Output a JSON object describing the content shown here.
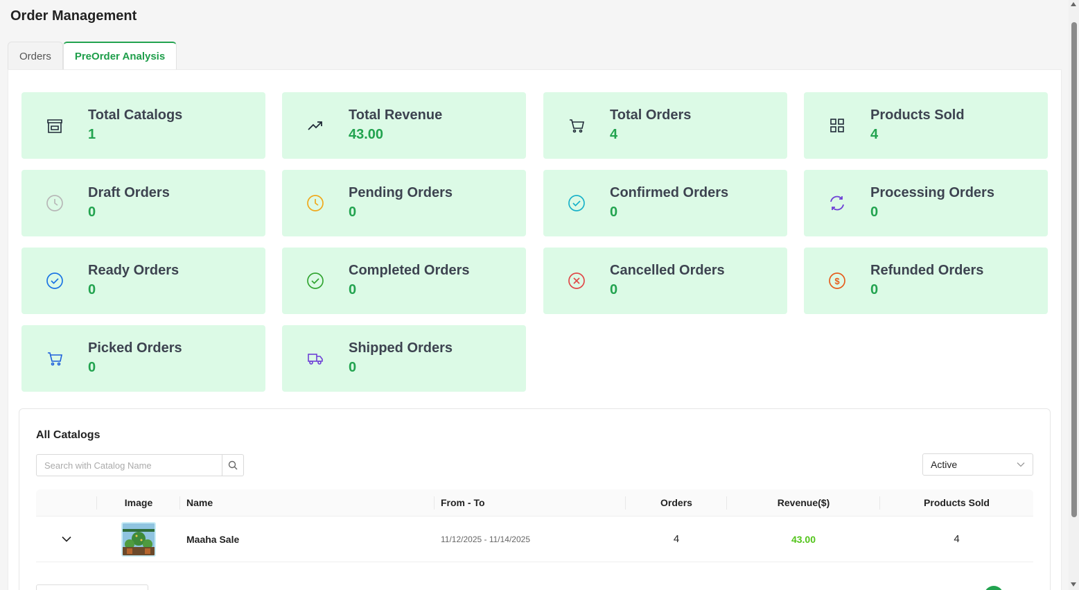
{
  "page": {
    "title": "Order Management"
  },
  "tabs": [
    {
      "label": "Orders",
      "active": false
    },
    {
      "label": "PreOrder Analysis",
      "active": true
    }
  ],
  "stats": [
    {
      "label": "Total Catalogs",
      "value": "1",
      "icon": "store-icon",
      "color": "#1f2937"
    },
    {
      "label": "Total Revenue",
      "value": "43.00",
      "icon": "trending-up-icon",
      "color": "#1f2937"
    },
    {
      "label": "Total Orders",
      "value": "4",
      "icon": "cart-icon",
      "color": "#1f2937"
    },
    {
      "label": "Products Sold",
      "value": "4",
      "icon": "grid-icon",
      "color": "#1f2937"
    },
    {
      "label": "Draft Orders",
      "value": "0",
      "icon": "clock-icon",
      "color": "#b7b7b7"
    },
    {
      "label": "Pending Orders",
      "value": "0",
      "icon": "clock-icon",
      "color": "#f0a81c"
    },
    {
      "label": "Confirmed Orders",
      "value": "0",
      "icon": "check-circle-icon",
      "color": "#19b2c9"
    },
    {
      "label": "Processing Orders",
      "value": "0",
      "icon": "sync-icon",
      "color": "#6d3fd6"
    },
    {
      "label": "Ready Orders",
      "value": "0",
      "icon": "check-circle-icon",
      "color": "#1b74e4"
    },
    {
      "label": "Completed Orders",
      "value": "0",
      "icon": "check-circle-icon",
      "color": "#32a532"
    },
    {
      "label": "Cancelled Orders",
      "value": "0",
      "icon": "x-circle-icon",
      "color": "#e04848"
    },
    {
      "label": "Refunded Orders",
      "value": "0",
      "icon": "dollar-circle-icon",
      "color": "#e65c1c"
    },
    {
      "label": "Picked Orders",
      "value": "0",
      "icon": "cart-icon",
      "color": "#1b5ddb"
    },
    {
      "label": "Shipped Orders",
      "value": "0",
      "icon": "truck-icon",
      "color": "#6d3fd6"
    }
  ],
  "catalogs": {
    "title": "All Catalogs",
    "search_placeholder": "Search with Catalog Name",
    "status_filter": "Active",
    "columns": [
      "",
      "Image",
      "Name",
      "From - To",
      "Orders",
      "Revenue($)",
      "Products Sold"
    ],
    "rows": [
      {
        "name": "Maaha Sale",
        "date_range": "11/12/2025 - 11/14/2025",
        "orders": "4",
        "revenue": "43.00",
        "products_sold": "4"
      }
    ]
  },
  "colors": {
    "accent": "#22a34f",
    "card_bg": "#dcfae6",
    "revenue_text": "#52c41a"
  }
}
